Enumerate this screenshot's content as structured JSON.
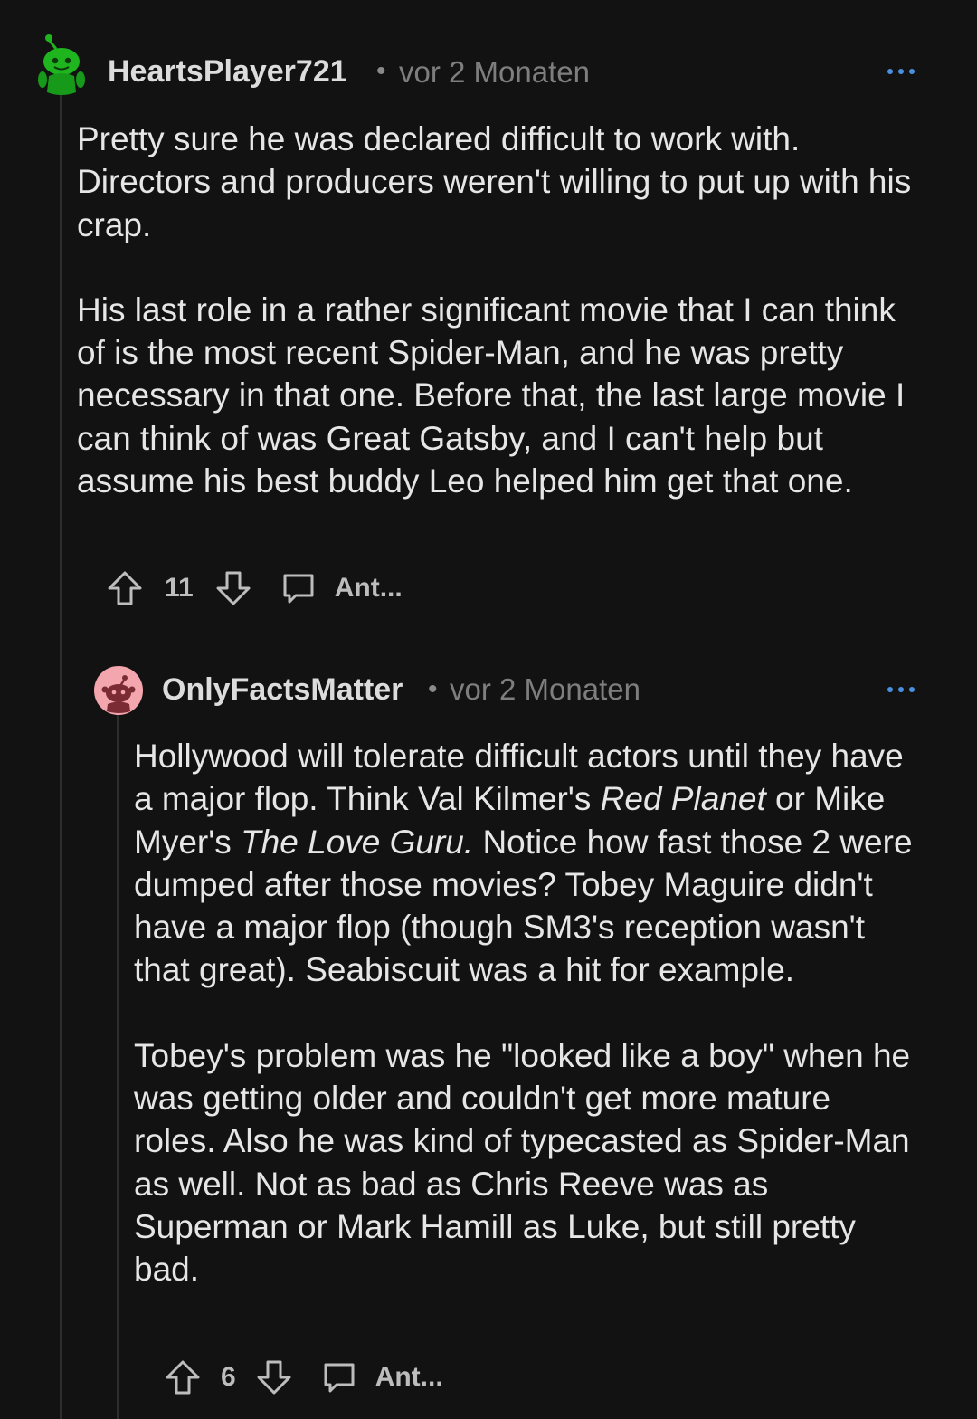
{
  "comments": [
    {
      "username": "HeartsPlayer721",
      "separator": "•",
      "timestamp": "vor 2 Monaten",
      "paragraphs": [
        "Pretty sure he was declared difficult to work with. Directors and producers weren't willing to put up with his crap.",
        "His last role in a rather significant movie that I can think of is the most recent Spider-Man, and he was pretty necessary in that one. Before that, the last large movie I can think of was Great Gatsby, and I can't help but assume his best buddy Leo helped him get that one."
      ],
      "votes": "11",
      "reply_label": "Ant...",
      "avatar_color": "#1fb51f",
      "avatar_icon": "green-snoo-icon"
    },
    {
      "username": "OnlyFactsMatter",
      "separator": "•",
      "timestamp": "vor 2 Monaten",
      "p1_parts": {
        "a": "Hollywood will tolerate difficult actors until they have a major flop. Think Val Kilmer's ",
        "b": "Red Planet",
        "c": " or Mike Myer's ",
        "d": "The Love Guru.",
        "e": " Notice how fast those 2 were dumped after those movies? Tobey Maguire didn't have a major flop (though SM3's reception wasn't that great). Seabiscuit was a hit for example."
      },
      "paragraph2": "Tobey's problem was he \"looked like a boy\" when he was getting older and couldn't get more mature roles. Also he was kind of typecasted as Spider-Man as well. Not as bad as Chris Reeve was as Superman or Mark Hamill as Luke, but still pretty bad.",
      "votes": "6",
      "reply_label": "Ant...",
      "avatar_color": "#f4a6ae",
      "avatar_icon": "pink-snoo-icon"
    }
  ],
  "colors": {
    "background": "#121212",
    "text": "#e6e6e6",
    "muted": "#7e7e7e",
    "thread_line": "#2e2e2e"
  }
}
